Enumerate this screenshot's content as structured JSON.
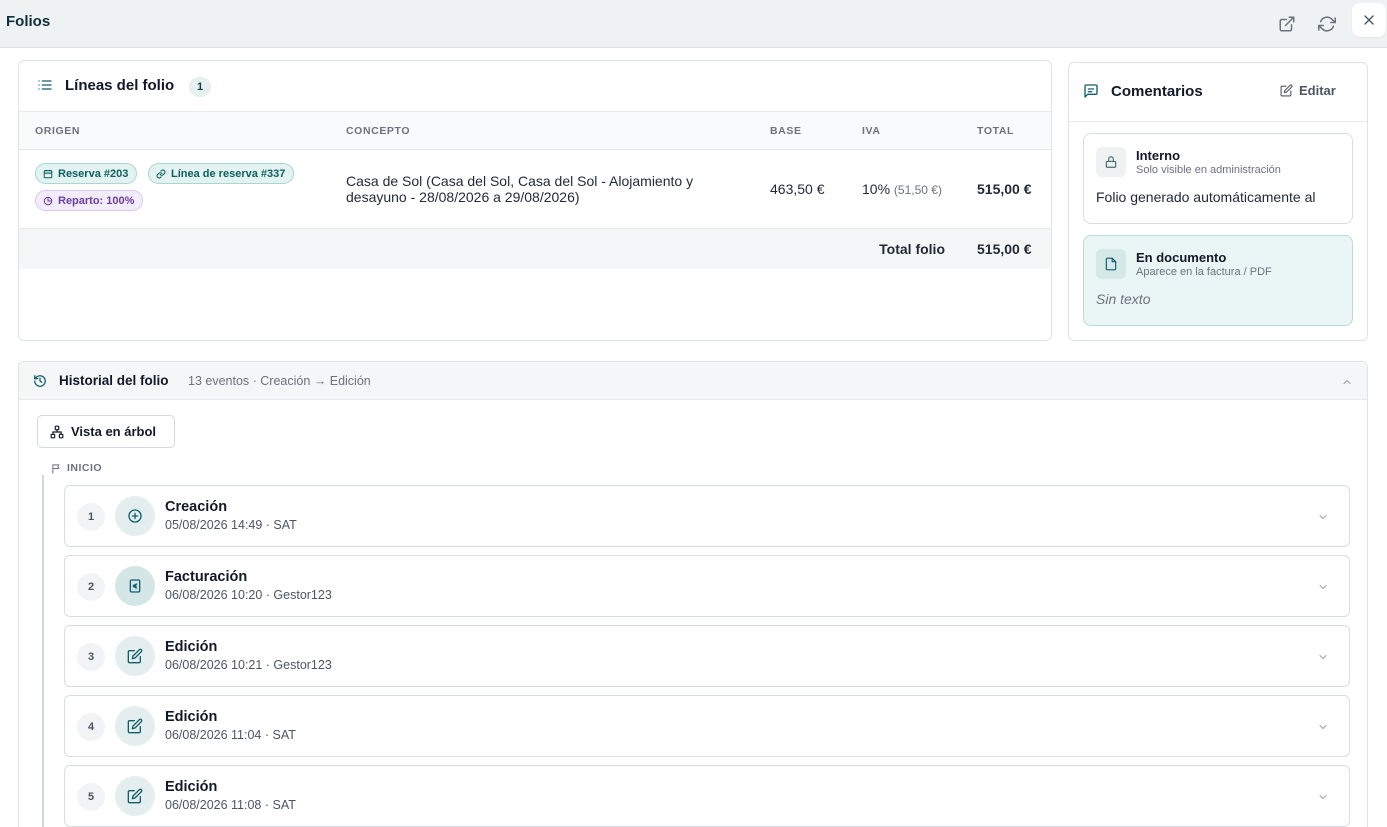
{
  "header": {
    "title": "Folios"
  },
  "lines": {
    "title": "Líneas del folio",
    "count": "1",
    "columns": [
      "ORIGEN",
      "CONCEPTO",
      "BASE",
      "IVA",
      "TOTAL"
    ],
    "row": {
      "chips": [
        "Reserva #203",
        "Línea de reserva #337",
        "Reparto: 100%"
      ],
      "concept": "Casa de Sol (Casa del Sol, Casa del Sol - Alojamiento y desayuno - 28/08/2026 a 29/08/2026)",
      "base": "463,50 €",
      "iva": "10%",
      "iva_amount": "(51,50 €)",
      "total": "515,00 €"
    },
    "footer_label": "Total folio",
    "footer_value": "515,00 €"
  },
  "comments": {
    "title": "Comentarios",
    "edit_label": "Editar",
    "internal": {
      "title": "Interno",
      "subtitle": "Solo visible en administración",
      "body": "Folio generado automáticamente al"
    },
    "document": {
      "title": "En documento",
      "subtitle": "Aparece en la factura / PDF",
      "body": "Sin texto"
    }
  },
  "history": {
    "title": "Historial del folio",
    "meta": "13 eventos · Creación → Edición",
    "tree_button": "Vista en árbol",
    "start_label": "INICIO",
    "events": [
      {
        "num": "1",
        "title": "Creación",
        "meta": "05/08/2026 14:49 · SAT",
        "icon": "plus-circle-icon"
      },
      {
        "num": "2",
        "title": "Facturación",
        "meta": "06/08/2026 10:20 · Gestor123",
        "icon": "invoice-euro-icon"
      },
      {
        "num": "3",
        "title": "Edición",
        "meta": "06/08/2026 10:21 · Gestor123",
        "icon": "edit-icon"
      },
      {
        "num": "4",
        "title": "Edición",
        "meta": "06/08/2026 11:04 · SAT",
        "icon": "edit-icon"
      },
      {
        "num": "5",
        "title": "Edición",
        "meta": "06/08/2026 11:08 · SAT",
        "icon": "edit-icon"
      }
    ]
  },
  "colors": {
    "accent": "#0f5f6c",
    "chip_teal": "#e2f3f2",
    "chip_purple": "#f3ecfa",
    "doc_note_bg": "#eaf5f5"
  }
}
